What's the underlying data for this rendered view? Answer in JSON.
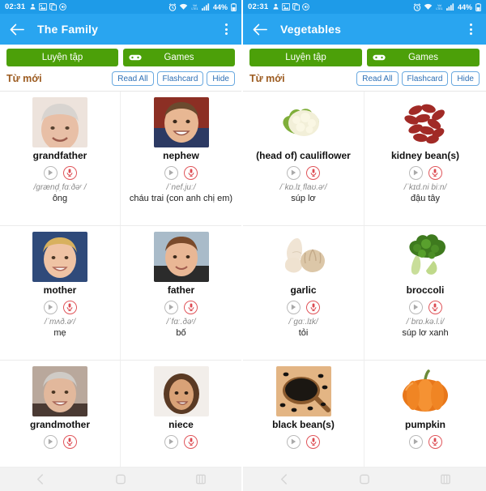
{
  "screens": [
    {
      "status": {
        "time": "02:31",
        "left_icons": [
          "person-data-icon",
          "image-icon",
          "copy-icon",
          "volume-icon"
        ],
        "right_icons": [
          "alarm-icon",
          "wifi-icon",
          "volte-icon",
          "signal-icon"
        ],
        "battery_text": "44%",
        "battery_icon": "battery-icon",
        "bg_color": "#1E9BE8"
      },
      "appbar": {
        "back_icon": "back-arrow-icon",
        "title": "The Family",
        "overflow_icon": "overflow-menu-icon",
        "bg_color": "#29A5F0"
      },
      "actions": {
        "practice_label": "Luyện tập",
        "games_label": "Games",
        "games_icon": "gamepad-icon",
        "color": "#4CA009"
      },
      "section": {
        "title": "Từ mới",
        "title_color": "#9C5B20",
        "pills": [
          "Read All",
          "Flashcard",
          "Hide"
        ]
      },
      "words": [
        {
          "word": "grandfather",
          "phonetic": "/ɡrænd̩ˌfɑːðəʳ /",
          "meaning": "ông",
          "image": "elderly-man-photo",
          "play_icon": "play-icon",
          "mic_icon": "microphone-icon"
        },
        {
          "word": "nephew",
          "phonetic": "/ˈnef.juː/",
          "meaning": "cháu trai (con anh chị em)",
          "image": "young-boy-photo",
          "play_icon": "play-icon",
          "mic_icon": "microphone-icon"
        },
        {
          "word": "mother",
          "phonetic": "/ˈmʌð.əʳ/",
          "meaning": "mẹ",
          "image": "woman-photo",
          "play_icon": "play-icon",
          "mic_icon": "microphone-icon"
        },
        {
          "word": "father",
          "phonetic": "/ˈfɑː.ðəʳ/",
          "meaning": "bố",
          "image": "man-photo",
          "play_icon": "play-icon",
          "mic_icon": "microphone-icon"
        },
        {
          "word": "grandmother",
          "phonetic": "",
          "meaning": "",
          "image": "elderly-woman-photo",
          "play_icon": "play-icon",
          "mic_icon": "microphone-icon"
        },
        {
          "word": "niece",
          "phonetic": "",
          "meaning": "",
          "image": "young-girl-photo",
          "play_icon": "play-icon",
          "mic_icon": "microphone-icon"
        }
      ],
      "navbar": [
        "back-nav-icon",
        "home-nav-icon",
        "recents-nav-icon"
      ]
    },
    {
      "status": {
        "time": "02:31",
        "left_icons": [
          "person-data-icon",
          "image-icon",
          "copy-icon",
          "volume-icon"
        ],
        "right_icons": [
          "alarm-icon",
          "wifi-icon",
          "volte-icon",
          "signal-icon"
        ],
        "battery_text": "44%",
        "battery_icon": "battery-icon",
        "bg_color": "#1E9BE8"
      },
      "appbar": {
        "back_icon": "back-arrow-icon",
        "title": "Vegetables",
        "overflow_icon": "overflow-menu-icon",
        "bg_color": "#29A5F0"
      },
      "actions": {
        "practice_label": "Luyện tập",
        "games_label": "Games",
        "games_icon": "gamepad-icon",
        "color": "#4CA009"
      },
      "section": {
        "title": "Từ mới",
        "title_color": "#9C5B20",
        "pills": [
          "Read All",
          "Flashcard",
          "Hide"
        ]
      },
      "words": [
        {
          "word": "(head of) cauliflower",
          "phonetic": "/ˈkɒ.lɪˌflaʊ.əʳ/",
          "meaning": "súp lơ",
          "image": "cauliflower-photo",
          "play_icon": "play-icon",
          "mic_icon": "microphone-icon"
        },
        {
          "word": "kidney bean(s)",
          "phonetic": "/ˈkɪd.ni biːn/",
          "meaning": "đậu tây",
          "image": "kidney-beans-photo",
          "play_icon": "play-icon",
          "mic_icon": "microphone-icon"
        },
        {
          "word": "garlic",
          "phonetic": "/ˈɡɑː.lɪk/",
          "meaning": "tỏi",
          "image": "garlic-photo",
          "play_icon": "play-icon",
          "mic_icon": "microphone-icon"
        },
        {
          "word": "broccoli",
          "phonetic": "/ˈbrɒ.kə.l.i/",
          "meaning": "súp lơ xanh",
          "image": "broccoli-photo",
          "play_icon": "play-icon",
          "mic_icon": "microphone-icon"
        },
        {
          "word": "black bean(s)",
          "phonetic": "",
          "meaning": "",
          "image": "black-beans-photo",
          "play_icon": "play-icon",
          "mic_icon": "microphone-icon"
        },
        {
          "word": "pumpkin",
          "phonetic": "",
          "meaning": "",
          "image": "pumpkin-photo",
          "play_icon": "play-icon",
          "mic_icon": "microphone-icon"
        }
      ],
      "navbar": [
        "back-nav-icon",
        "home-nav-icon",
        "recents-nav-icon"
      ]
    }
  ]
}
